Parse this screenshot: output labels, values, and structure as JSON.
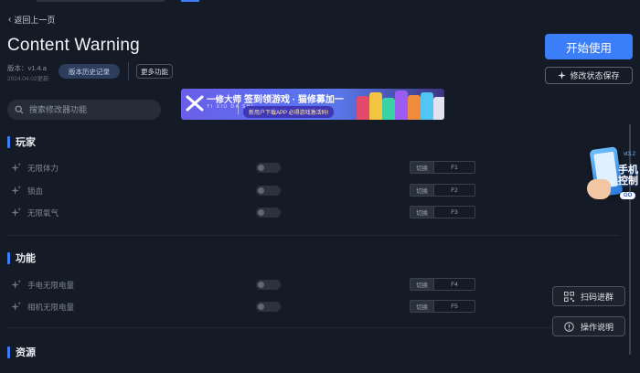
{
  "nav": {
    "back_label": "返回上一页"
  },
  "game": {
    "title": "Content Warning",
    "version": "版本：v1.4.a",
    "update_date": "2024.04.02更新"
  },
  "header_buttons": {
    "history": "版本历史记录",
    "more": "更多功能",
    "start": "开始使用",
    "save_state": "修改状态保存"
  },
  "search": {
    "placeholder": "搜索修改器功能"
  },
  "banner": {
    "brand": "一修大师",
    "brand_sub": "YI XIU DA SHI",
    "headline": "签到领游戏 · 猫修募加一",
    "subline": "新用户下载APP 必得游戏激活码!"
  },
  "sections": [
    {
      "title": "玩家",
      "items": [
        {
          "label": "无限体力",
          "action": "切换",
          "key": "F1"
        },
        {
          "label": "锁血",
          "action": "切换",
          "key": "F2"
        },
        {
          "label": "无限氧气",
          "action": "切换",
          "key": "F3"
        }
      ]
    },
    {
      "title": "功能",
      "items": [
        {
          "label": "手电无限电量",
          "action": "切换",
          "key": "F4"
        },
        {
          "label": "相机无限电量",
          "action": "切换",
          "key": "F5"
        }
      ]
    },
    {
      "title": "资源",
      "items": []
    }
  ],
  "side": {
    "phone_text_1": "手机",
    "phone_text_2": "控制",
    "phone_tag": "vt3.2",
    "phone_go": "GO",
    "scan_group": "扫码进群",
    "instructions": "操作说明"
  },
  "colors": {
    "accent": "#3b7ef8",
    "background": "#151b26"
  }
}
